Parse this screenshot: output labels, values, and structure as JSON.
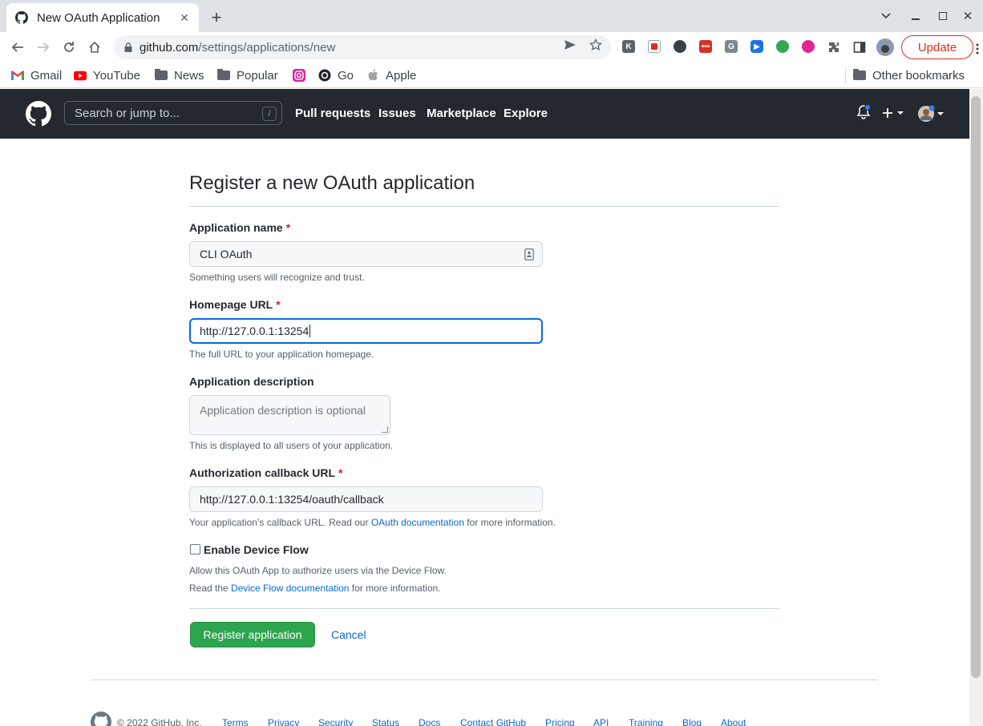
{
  "browser": {
    "tab_title": "New OAuth Application",
    "url_host": "github.com",
    "url_path": "/settings/applications/new",
    "update_label": "Update",
    "bookmarks": [
      "Gmail",
      "YouTube",
      "News",
      "Popular",
      "Go",
      "Apple"
    ],
    "other_bookmarks": "Other bookmarks",
    "extension_k": "K",
    "extension_g": "G"
  },
  "github_header": {
    "search_placeholder": "Search or jump to...",
    "search_shortcut": "/",
    "nav": [
      "Pull requests",
      "Issues",
      "Marketplace",
      "Explore"
    ]
  },
  "form": {
    "title": "Register a new OAuth application",
    "app_name": {
      "label": "Application name",
      "required": "*",
      "value": "CLI OAuth",
      "note": "Something users will recognize and trust."
    },
    "homepage": {
      "label": "Homepage URL",
      "required": "*",
      "value": "http://127.0.0.1:13254",
      "note": "The full URL to your application homepage."
    },
    "description": {
      "label": "Application description",
      "placeholder": "Application description is optional",
      "note": "This is displayed to all users of your application."
    },
    "callback": {
      "label": "Authorization callback URL",
      "required": "*",
      "value": "http://127.0.0.1:13254/oauth/callback",
      "note_before": "Your application’s callback URL. Read our",
      "note_link": "OAuth documentation",
      "note_after": "for more information."
    },
    "device_flow": {
      "label": "Enable Device Flow",
      "checked": false,
      "note1": "Allow this OAuth App to authorize users via the Device Flow.",
      "note2_before": "Read the",
      "note2_link": "Device Flow documentation",
      "note2_after": "for more information."
    },
    "submit_label": "Register application",
    "cancel_label": "Cancel"
  },
  "footer": {
    "copyright": "© 2022 GitHub, Inc.",
    "links": [
      "Terms",
      "Privacy",
      "Security",
      "Status",
      "Docs",
      "Contact GitHub",
      "Pricing",
      "API",
      "Training",
      "Blog",
      "About"
    ]
  },
  "colors": {
    "header_bg": "#24292f",
    "primary_button": "#2da44e",
    "link": "#0969da",
    "required": "#cf222e",
    "focus_border": "#0969da",
    "update_red": "#d93025"
  }
}
